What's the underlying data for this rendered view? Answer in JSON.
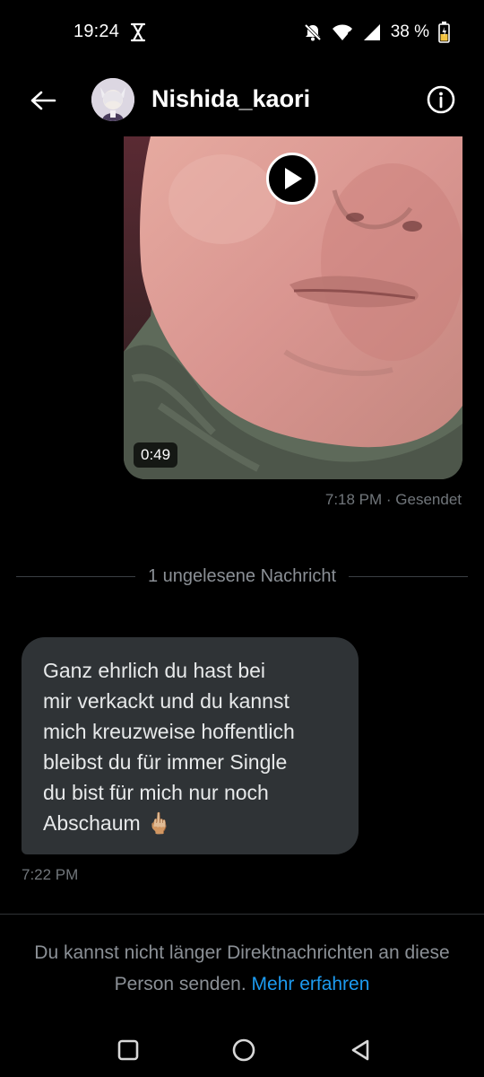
{
  "status_bar": {
    "time": "19:24",
    "battery": "38 %",
    "icons": [
      "hourglass-icon",
      "mute-icon",
      "wifi-icon",
      "signal-icon",
      "battery-icon"
    ]
  },
  "header": {
    "contact_name": "Nishida_kaori",
    "back_icon": "arrow-left-icon",
    "info_icon": "info-icon"
  },
  "messages": {
    "sent_video": {
      "duration": "0:49",
      "meta": "7:18 PM · Gesendet"
    },
    "unread_divider": "1 ungelesene Nachricht",
    "received": {
      "text": "Ganz ehrlich du hast bei\nmir verkackt und du kannst\nmich kreuzweise hoffentlich\nbleibst du für immer Single\ndu bist für mich nur noch\nAbschaum 🖕🏼",
      "time": "7:22 PM"
    }
  },
  "footer": {
    "notice": "Du kannst nicht länger Direktnachrichten an diese Person senden.",
    "link": "Mehr erfahren"
  },
  "colors": {
    "background": "#000000",
    "bubble_received": "#2f3336",
    "link": "#1d9bf0",
    "meta": "#71767b"
  }
}
